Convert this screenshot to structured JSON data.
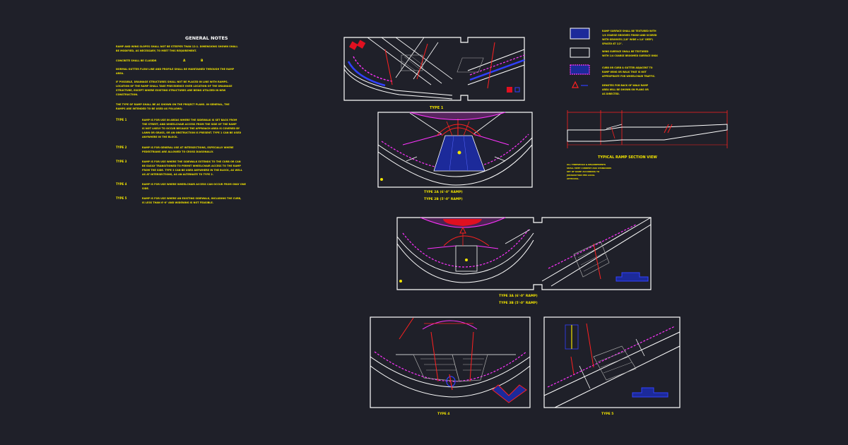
{
  "notes": {
    "title": "GENERAL NOTES",
    "lines": [
      "RAMP AND WING SLOPES SHALL NOT BE STEEPER THAN 12:1. DIMENSIONS SHOWN SHALL",
      "BE MODIFIED, AS NECESSARY, TO MEET THIS REQUIREMENT.",
      "CONCRETE SHALL BE CLASS",
      "NORMAL GUTTER FLOW LINE AND PROFILE SHALL BE MAINTAINED THROUGH THE RAMP",
      "AREA.",
      "IF POSSIBLE, DRAINAGE STRUCTURES SHALL NOT BE PLACED IN LINE WITH RAMPS.",
      "LOCATION OF THE RAMP SHALL TAKE PRECEDENCE OVER LOCATION OF THE DRAINAGE",
      "STRUCTURE, EXCEPT WHERE EXISTING STRUCTURES ARE BEING UTILIZED IN NEW",
      "CONSTRUCTION.",
      "THE TYPE OF RAMP SHALL BE AS SHOWN ON THE PROJECT PLANS. IN GENERAL, THE",
      "RAMPS ARE INTENDED TO BE USED AS FOLLOWS:"
    ],
    "class_or": "OR",
    "class_a": "A",
    "class_b": "B",
    "types": [
      {
        "label": "TYPE 1",
        "lines": [
          "RAMP IS FOR USE IN AREAS WHERE THE SIDEWALK IS SET BACK FROM",
          "THE STREET, AND WHEELCHAIR ACCESS FROM THE SIDE OF THE RAMP",
          "IS NOT LIKELY TO OCCUR BECAUSE THE APPROACH AREA IS COVERED BY",
          "LAWN OR GRASS, OR AN OBSTRUCTION IS PRESENT. TYPE 1 CAN BE USED",
          "ANYWHERE IN THE BLOCK."
        ]
      },
      {
        "label": "TYPE 2",
        "lines": [
          "RAMP IS FOR GENERAL USE AT INTERSECTIONS, ESPECIALLY WHERE",
          "PEDESTRIANS ARE ALLOWED TO CROSS DIAGONALLY."
        ]
      },
      {
        "label": "TYPE 3",
        "lines": [
          "RAMP IS FOR USE WHERE THE SIDEWALK EXTENDS TO THE CURB OR CAN",
          "BE EASILY TRANSITIONED TO PERMIT WHEELCHAIR ACCESS TO THE RAMP",
          "FROM THE SIDE. TYPE 3 CAN BE USED ANYWHERE IN THE BLOCK, AS WELL",
          "AS AT INTERSECTIONS, AS AN ALTERNATE TO TYPE 2."
        ]
      },
      {
        "label": "TYPE 4",
        "lines": [
          "RAMP IS FOR USE WHERE WHEELCHAIR ACCESS CAN OCCUR FROM ONLY ONE",
          "SIDE."
        ]
      },
      {
        "label": "TYPE 5",
        "lines": [
          "RAMP IS FOR USE WHERE AN EXISTING SIDEWALK, INCLUDING THE CURB,",
          "IS LESS THAN 6'-0\" AND WIDENING IS NOT FEASIBLE."
        ]
      }
    ]
  },
  "legend": [
    {
      "lines": [
        "RAMP SURFACE SHALL BE TEXTURED WITH",
        "1/4 COARSE GROOVES FINISH AND SCORED",
        "WITH GROOVES (1/8\" WIDE x 1/4\" DEEP)",
        "SPACED AT 1/2\"."
      ]
    },
    {
      "lines": [
        "WING SURFACE SHALL BE TEXTURED",
        "WITH 1/4 COARSE BROOMED SURFACE ONLY."
      ]
    },
    {
      "lines": [
        "CURB OR CURB & GUTTER ADJACENT TO",
        "RAMP WING OR WALK THAT IS NOT",
        "APPROPRIATE FOR WHEELCHAIR TRAFFIC."
      ]
    },
    {
      "lines": [
        "DENOTES FOR BACK OF WALK RAMP",
        "AREA WILL BE SHOWN ON PLANS OR",
        "AS DIRECTED."
      ]
    }
  ],
  "section": {
    "title": "TYPICAL RAMP SECTION VIEW",
    "notes": [
      "ALL THRESHOLD & REQUIREMENTS",
      "SHALL MEET CURRENT ADA STANDARDS",
      "SET OF RAMP ACCORDING TO",
      "JURISDICTION PER LOCAL",
      "APPROVAL."
    ]
  },
  "captions": {
    "type1": "TYPE 1",
    "type2a": "TYPE 2A (6'-0\" RAMP)",
    "type2b": "TYPE 2B (5'-0\" RAMP)",
    "type3a": "TYPE 3A (6'-0\" RAMP)",
    "type3b": "TYPE 3B (5'-0\" RAMP)",
    "type4": "TYPE 4",
    "type5": "TYPE 5"
  }
}
